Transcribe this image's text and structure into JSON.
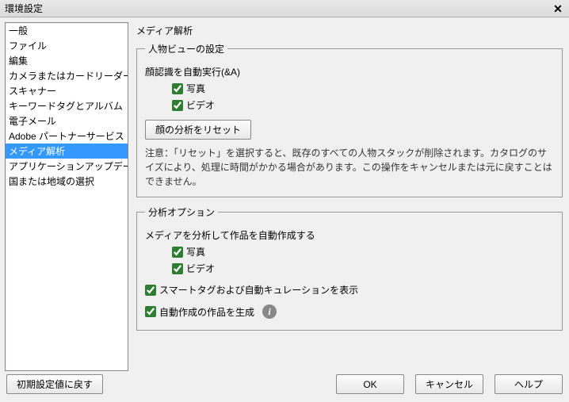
{
  "window": {
    "title": "環境設定"
  },
  "sidebar": {
    "items": [
      {
        "label": "一般"
      },
      {
        "label": "ファイル"
      },
      {
        "label": "編集"
      },
      {
        "label": "カメラまたはカードリーダー"
      },
      {
        "label": "スキャナー"
      },
      {
        "label": "キーワードタグとアルバム"
      },
      {
        "label": "電子メール"
      },
      {
        "label": "Adobe パートナーサービス"
      },
      {
        "label": "メディア解析"
      },
      {
        "label": "アプリケーションアップデート"
      },
      {
        "label": "国または地域の選択"
      }
    ],
    "selected_index": 8
  },
  "page": {
    "title": "メディア解析",
    "people_section": {
      "legend": "人物ビューの設定",
      "face_auto_label": "顔認識を自動実行(&A)",
      "photo_label": "写真",
      "video_label": "ビデオ",
      "photo_checked": true,
      "video_checked": true,
      "reset_button": "顔の分析をリセット",
      "note": "注意：「リセット」を選択すると、既存のすべての人物スタックが削除されます。カタログのサイズにより、処理に時間がかかる場合があります。この操作をキャンセルまたは元に戻すことはできません。"
    },
    "analysis_section": {
      "legend": "分析オプション",
      "auto_create_label": "メディアを分析して作品を自動作成する",
      "photo_label": "写真",
      "video_label": "ビデオ",
      "photo_checked": true,
      "video_checked": true,
      "smart_tags_label": "スマートタグおよび自動キュレーションを表示",
      "smart_tags_checked": true,
      "generate_label": "自動作成の作品を生成",
      "generate_checked": true
    }
  },
  "buttons": {
    "restore": "初期設定値に戻す",
    "ok": "OK",
    "cancel": "キャンセル",
    "help": "ヘルプ"
  }
}
